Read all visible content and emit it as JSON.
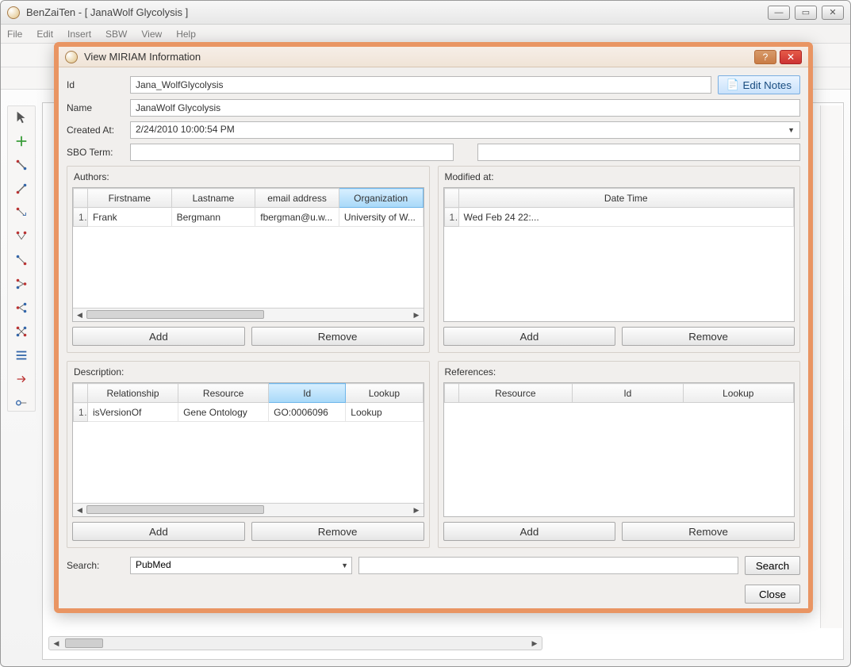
{
  "app": {
    "title": "BenZaiTen - [ JanaWolf Glycolysis ]",
    "menus": [
      "File",
      "Edit",
      "Insert",
      "SBW",
      "View",
      "Help"
    ]
  },
  "dialog": {
    "title": "View MIRIAM Information",
    "fields": {
      "id_label": "Id",
      "id_value": "Jana_WolfGlycolysis",
      "name_label": "Name",
      "name_value": "JanaWolf Glycolysis",
      "created_label": "Created At:",
      "created_value": "2/24/2010 10:00:54 PM",
      "sbo_label": "SBO Term:",
      "sbo_left": "",
      "sbo_right": "",
      "edit_notes": "Edit Notes"
    },
    "authors": {
      "title": "Authors:",
      "columns": [
        "Firstname",
        "Lastname",
        "email address",
        "Organization"
      ],
      "selected_col": 3,
      "rows": [
        {
          "n": "1",
          "Firstname": "Frank",
          "Lastname": "Bergmann",
          "email": "fbergman@u.w...",
          "Organization": "University of W..."
        }
      ],
      "add": "Add",
      "remove": "Remove"
    },
    "modified": {
      "title": "Modified at:",
      "columns": [
        "Date Time"
      ],
      "rows": [
        {
          "n": "1",
          "DateTime": "Wed Feb 24 22:..."
        }
      ],
      "add": "Add",
      "remove": "Remove"
    },
    "description": {
      "title": "Description:",
      "columns": [
        "Relationship",
        "Resource",
        "Id",
        "Lookup"
      ],
      "selected_col": 2,
      "rows": [
        {
          "n": "1",
          "Relationship": "isVersionOf",
          "Resource": "Gene Ontology",
          "Id": "GO:0006096",
          "Lookup": "Lookup"
        }
      ],
      "add": "Add",
      "remove": "Remove"
    },
    "references": {
      "title": "References:",
      "columns": [
        "Resource",
        "Id",
        "Lookup"
      ],
      "rows": [],
      "add": "Add",
      "remove": "Remove"
    },
    "search": {
      "label": "Search:",
      "source": "PubMed",
      "query": "",
      "button": "Search"
    },
    "close": "Close"
  }
}
